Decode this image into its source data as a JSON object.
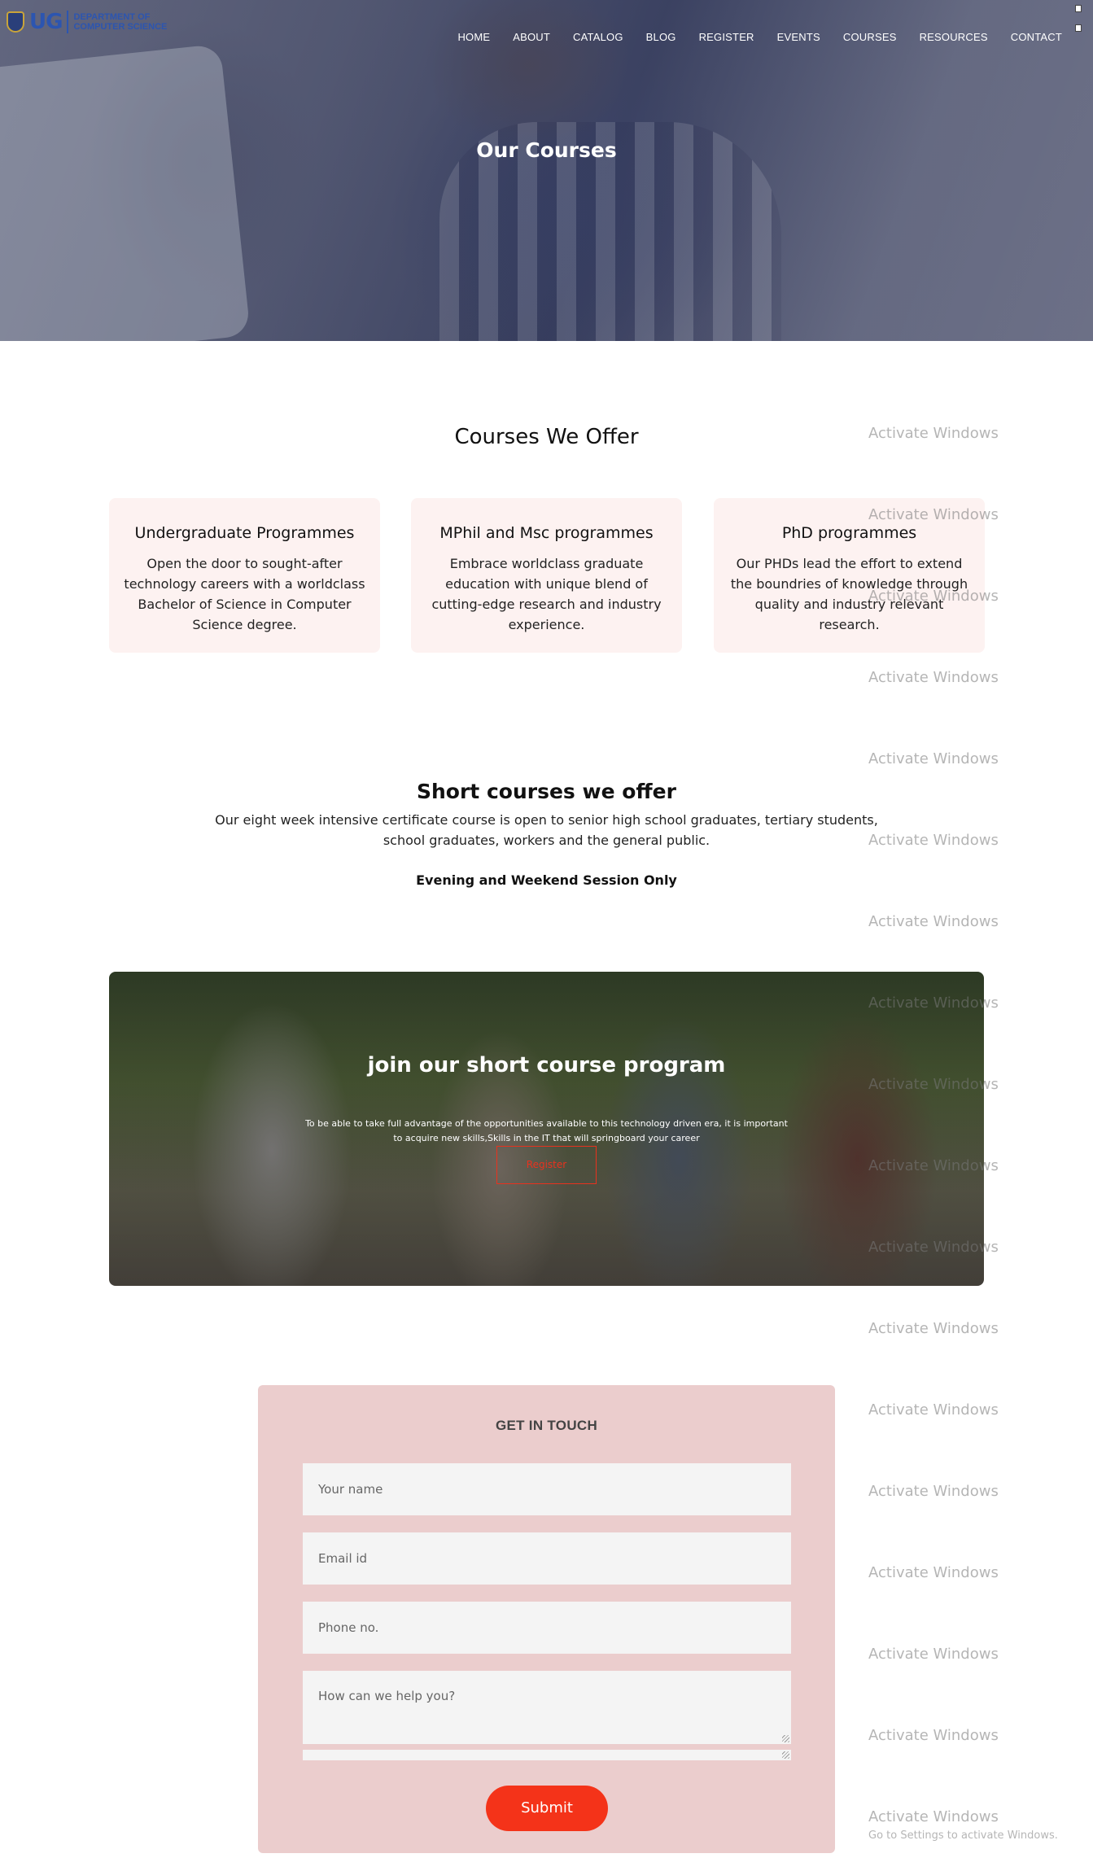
{
  "header": {
    "logo_ug": "UG",
    "logo_line1": "DEPARTMENT OF",
    "logo_line2": "COMPUTER SCIENCE",
    "nav": [
      "HOME",
      "ABOUT",
      "CATALOG",
      "BLOG",
      "REGISTER",
      "EVENTS",
      "COURSES",
      "RESOURCES",
      "CONTACT"
    ],
    "hero_title": "Our Courses"
  },
  "courses": {
    "title": "Courses We Offer",
    "cards": [
      {
        "title": "Undergraduate Programmes",
        "text": "Open the door to sought-after technology careers with a worldclass Bachelor of Science in Computer Science degree."
      },
      {
        "title": "MPhil and Msc programmes",
        "text": "Embrace worldclass graduate education with unique blend of cutting-edge research and industry experience."
      },
      {
        "title": "PhD programmes",
        "text": "Our PHDs lead the effort to extend the boundries of knowledge through quality and industry relevant research."
      }
    ]
  },
  "short": {
    "title": "Short courses we offer",
    "desc": "Our eight week intensive certificate course is open to senior high school graduates, tertiary students, school graduates, workers and the general public.",
    "note": "Evening and Weekend Session Only"
  },
  "banner": {
    "title": "join our short course program",
    "text": "To be able to take full advantage of the opportunities available to this technology driven era, it is important to acquire new skills,Skills in the IT that will springboard your career",
    "button": "Register"
  },
  "contact": {
    "title": "GET IN TOUCH",
    "name_placeholder": "Your name",
    "email_placeholder": "Email id",
    "phone_placeholder": "Phone no.",
    "message_placeholder": "How can we help you?",
    "submit": "Submit"
  },
  "watermark": {
    "text": "Activate Windows",
    "sub": "Go to Settings to activate Windows."
  }
}
